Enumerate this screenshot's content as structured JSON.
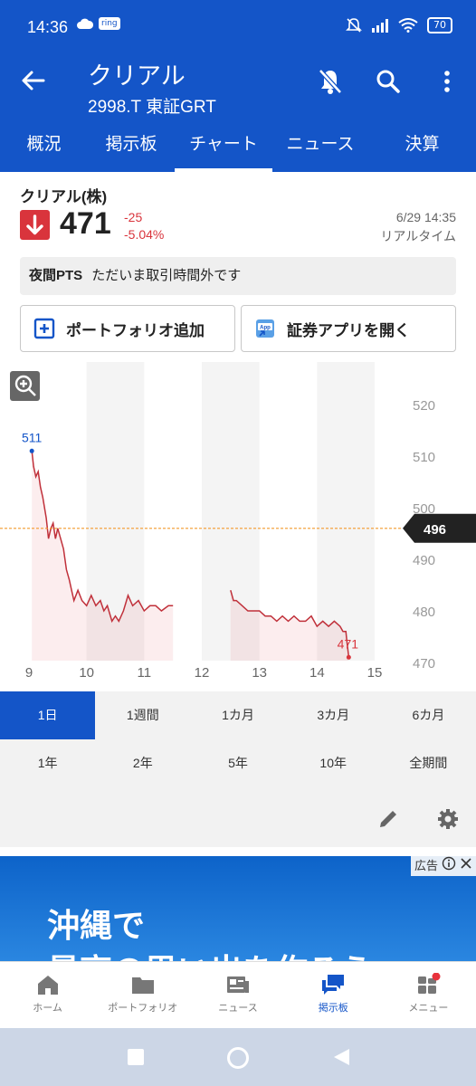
{
  "status_bar": {
    "time": "14:36",
    "ring_badge": "ring",
    "battery": "70"
  },
  "app_bar": {
    "title": "クリアル",
    "subtitle": "2998.T 東証GRT"
  },
  "tabs": [
    {
      "label": "概況",
      "active": false
    },
    {
      "label": "掲示板",
      "active": false
    },
    {
      "label": "チャート",
      "active": true
    },
    {
      "label": "ニュース",
      "active": false
    },
    {
      "label": "決算",
      "active": false
    }
  ],
  "stock": {
    "name": "クリアル(株)",
    "price": "471",
    "change": "-25",
    "change_pct": "-5.04%",
    "datetime": "6/29 14:35",
    "realtime_label": "リアルタイム"
  },
  "pts": {
    "label": "夜間PTS",
    "message": "ただいま取引時間外です"
  },
  "buttons": {
    "portfolio": "ポートフォリオ追加",
    "securities_app": "証券アプリを開く"
  },
  "chart_data": {
    "type": "line",
    "x_ticks": [
      "9",
      "10",
      "11",
      "12",
      "13",
      "14",
      "15"
    ],
    "y_ticks": [
      "520",
      "510",
      "500",
      "490",
      "480",
      "470"
    ],
    "ylim": [
      470,
      520
    ],
    "xlim": [
      9,
      15
    ],
    "prev_close_label": "496",
    "prev_close_value": 496,
    "high_label": "511",
    "low_label": "471",
    "morning_session": [
      [
        9.05,
        511
      ],
      [
        9.08,
        508
      ],
      [
        9.12,
        506
      ],
      [
        9.16,
        507
      ],
      [
        9.2,
        504
      ],
      [
        9.24,
        502
      ],
      [
        9.3,
        498
      ],
      [
        9.34,
        494
      ],
      [
        9.38,
        496
      ],
      [
        9.42,
        497
      ],
      [
        9.46,
        494
      ],
      [
        9.5,
        496
      ],
      [
        9.55,
        494
      ],
      [
        9.6,
        492
      ],
      [
        9.65,
        488
      ],
      [
        9.7,
        486
      ],
      [
        9.74,
        484
      ],
      [
        9.78,
        482
      ],
      [
        9.85,
        484
      ],
      [
        9.92,
        482
      ],
      [
        10.0,
        481
      ],
      [
        10.08,
        483
      ],
      [
        10.16,
        481
      ],
      [
        10.24,
        482
      ],
      [
        10.3,
        480
      ],
      [
        10.36,
        481
      ],
      [
        10.44,
        478
      ],
      [
        10.5,
        479
      ],
      [
        10.56,
        478
      ],
      [
        10.64,
        480
      ],
      [
        10.72,
        483
      ],
      [
        10.8,
        481
      ],
      [
        10.9,
        482
      ],
      [
        11.0,
        480
      ],
      [
        11.1,
        481
      ],
      [
        11.2,
        481
      ],
      [
        11.3,
        480
      ],
      [
        11.42,
        481
      ],
      [
        11.5,
        481
      ]
    ],
    "afternoon_session": [
      [
        12.5,
        484
      ],
      [
        12.55,
        482
      ],
      [
        12.6,
        482
      ],
      [
        12.7,
        481
      ],
      [
        12.8,
        480
      ],
      [
        12.9,
        480
      ],
      [
        13.0,
        480
      ],
      [
        13.1,
        479
      ],
      [
        13.2,
        479
      ],
      [
        13.3,
        478
      ],
      [
        13.4,
        479
      ],
      [
        13.5,
        478
      ],
      [
        13.6,
        479
      ],
      [
        13.7,
        478
      ],
      [
        13.8,
        478
      ],
      [
        13.9,
        479
      ],
      [
        14.0,
        477
      ],
      [
        14.1,
        478
      ],
      [
        14.2,
        477
      ],
      [
        14.3,
        478
      ],
      [
        14.4,
        477
      ],
      [
        14.45,
        476
      ],
      [
        14.5,
        476
      ],
      [
        14.52,
        474
      ],
      [
        14.55,
        471
      ]
    ]
  },
  "periods_row1": [
    "1日",
    "1週間",
    "1カ月",
    "3カ月",
    "6カ月"
  ],
  "periods_row2": [
    "1年",
    "2年",
    "5年",
    "10年",
    "全期間"
  ],
  "ad": {
    "badge": "広告",
    "line1": "沖縄で",
    "line2": "最高の思い出を作ろう"
  },
  "bottom_nav": [
    {
      "label": "ホーム",
      "icon": "home-icon",
      "active": false
    },
    {
      "label": "ポートフォリオ",
      "icon": "folder-icon",
      "active": false
    },
    {
      "label": "ニュース",
      "icon": "news-icon",
      "active": false
    },
    {
      "label": "掲示板",
      "icon": "chat-icon",
      "active": true
    },
    {
      "label": "メニュー",
      "icon": "menu-grid-icon",
      "active": false
    }
  ],
  "colors": {
    "primary": "#1455c8",
    "down_red": "#d9343c",
    "line_red": "#c0303a",
    "prev_close": "#f39a2b"
  }
}
